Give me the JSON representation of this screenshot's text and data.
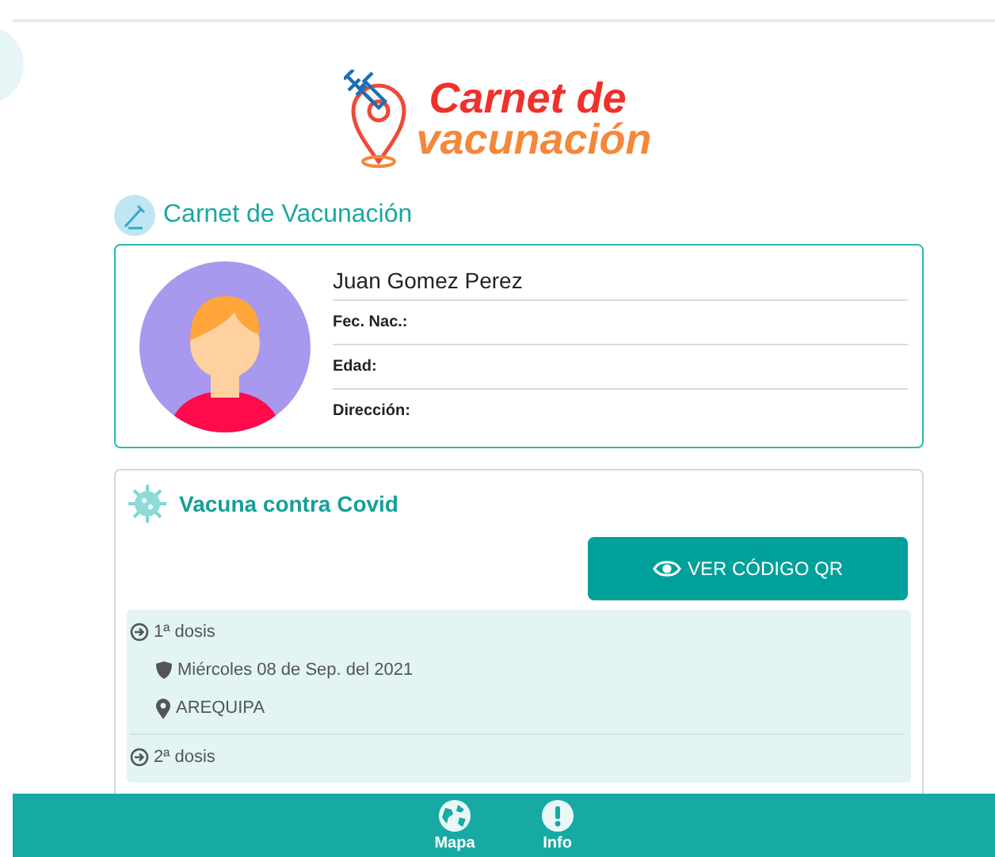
{
  "logo": {
    "line_1": "Carnet de",
    "line_2": "vacunación"
  },
  "section_title": "Carnet de Vacunación",
  "person": {
    "name": "Juan Gomez Perez",
    "fields": [
      "Fec. Nac.:",
      "Edad:",
      "Dirección:"
    ]
  },
  "vaccine": {
    "title": "Vacuna contra Covid",
    "qr_button": "VER CÓDIGO QR",
    "doses": [
      {
        "title": "1ª dosis",
        "date": "Miércoles 08 de Sep. del 2021",
        "place": "AREQUIPA"
      },
      {
        "title": "2ª dosis"
      }
    ]
  },
  "bottom_nav": [
    {
      "label": "Mapa",
      "kind": "globe"
    },
    {
      "label": "Info",
      "kind": "alert"
    }
  ]
}
